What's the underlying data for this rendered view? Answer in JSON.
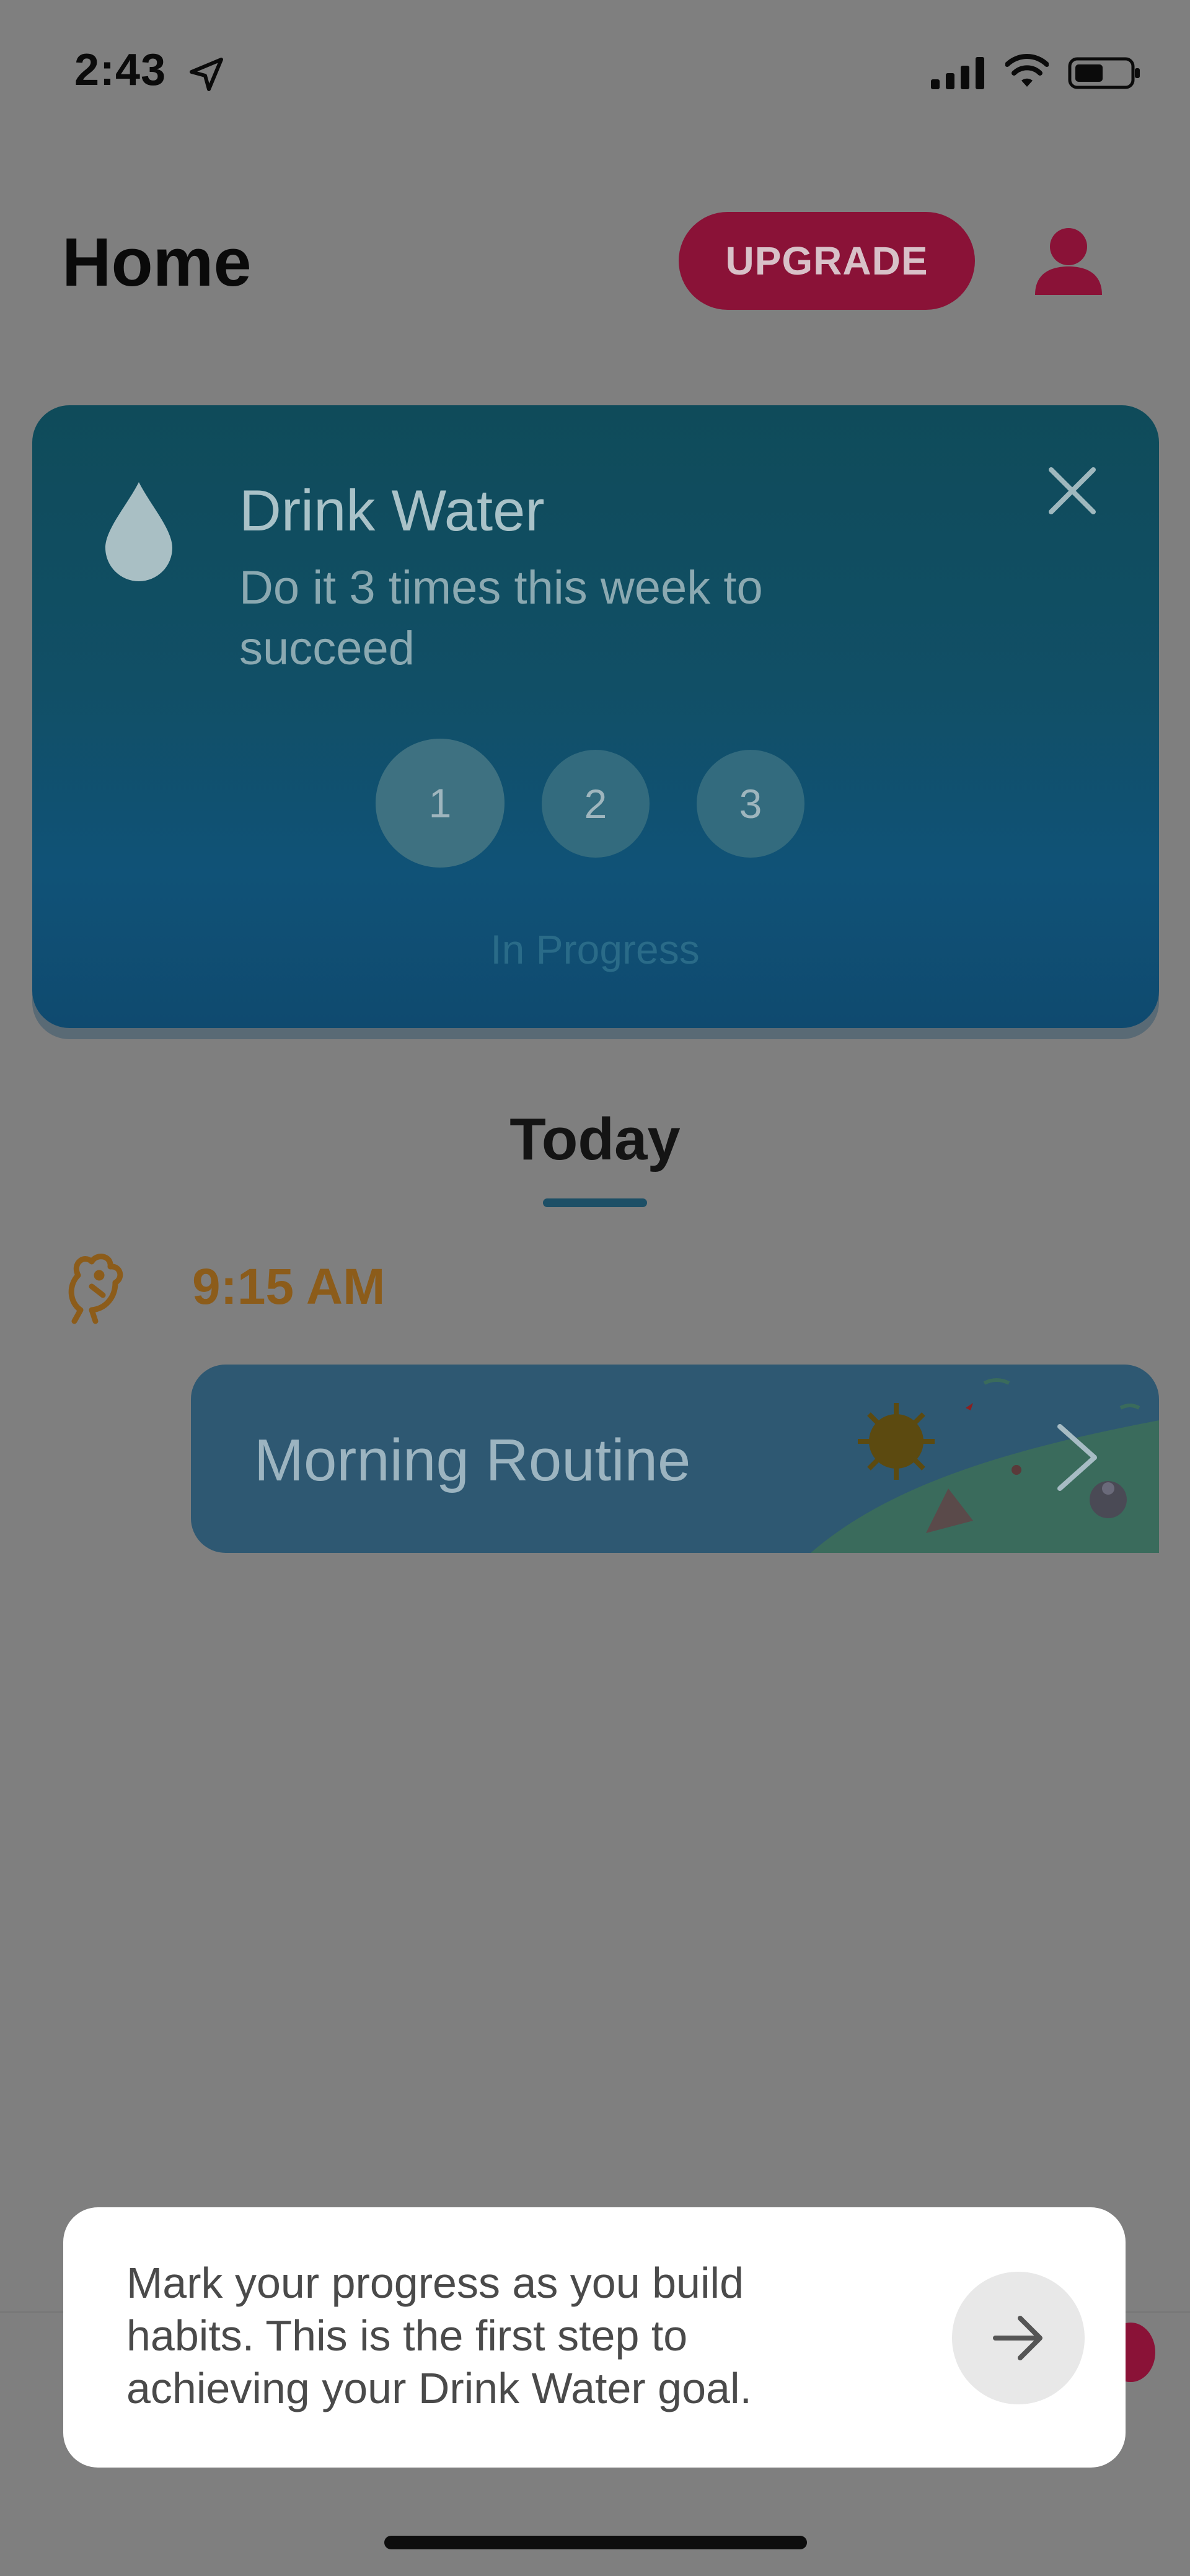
{
  "status_bar": {
    "time": "2:43",
    "icons": [
      "location-arrow-icon",
      "cellular-signal-icon",
      "wifi-icon",
      "battery-icon"
    ]
  },
  "header": {
    "title": "Home",
    "upgrade_label": "UPGRADE",
    "profile_icon": "user-profile-icon"
  },
  "habit_card": {
    "icon": "water-drop-icon",
    "title": "Drink Water",
    "description": "Do it 3 times this week to succeed",
    "steps": [
      "1",
      "2",
      "3"
    ],
    "status": "In Progress",
    "close_icon": "close-icon"
  },
  "today": {
    "label": "Today"
  },
  "routine": {
    "icon": "rooster-icon",
    "time": "9:15 AM",
    "label": "Morning Routine",
    "chevron_icon": "chevron-right-icon"
  },
  "tooltip": {
    "text": "Mark your progress as you build habits. This is the first step to achieving your Drink Water goal.",
    "next_icon": "arrow-right-icon"
  },
  "colors": {
    "accent": "#8a1237",
    "routine_time": "#8c5c1a",
    "card": "#114f66",
    "overlay": "#7f7f7f"
  }
}
